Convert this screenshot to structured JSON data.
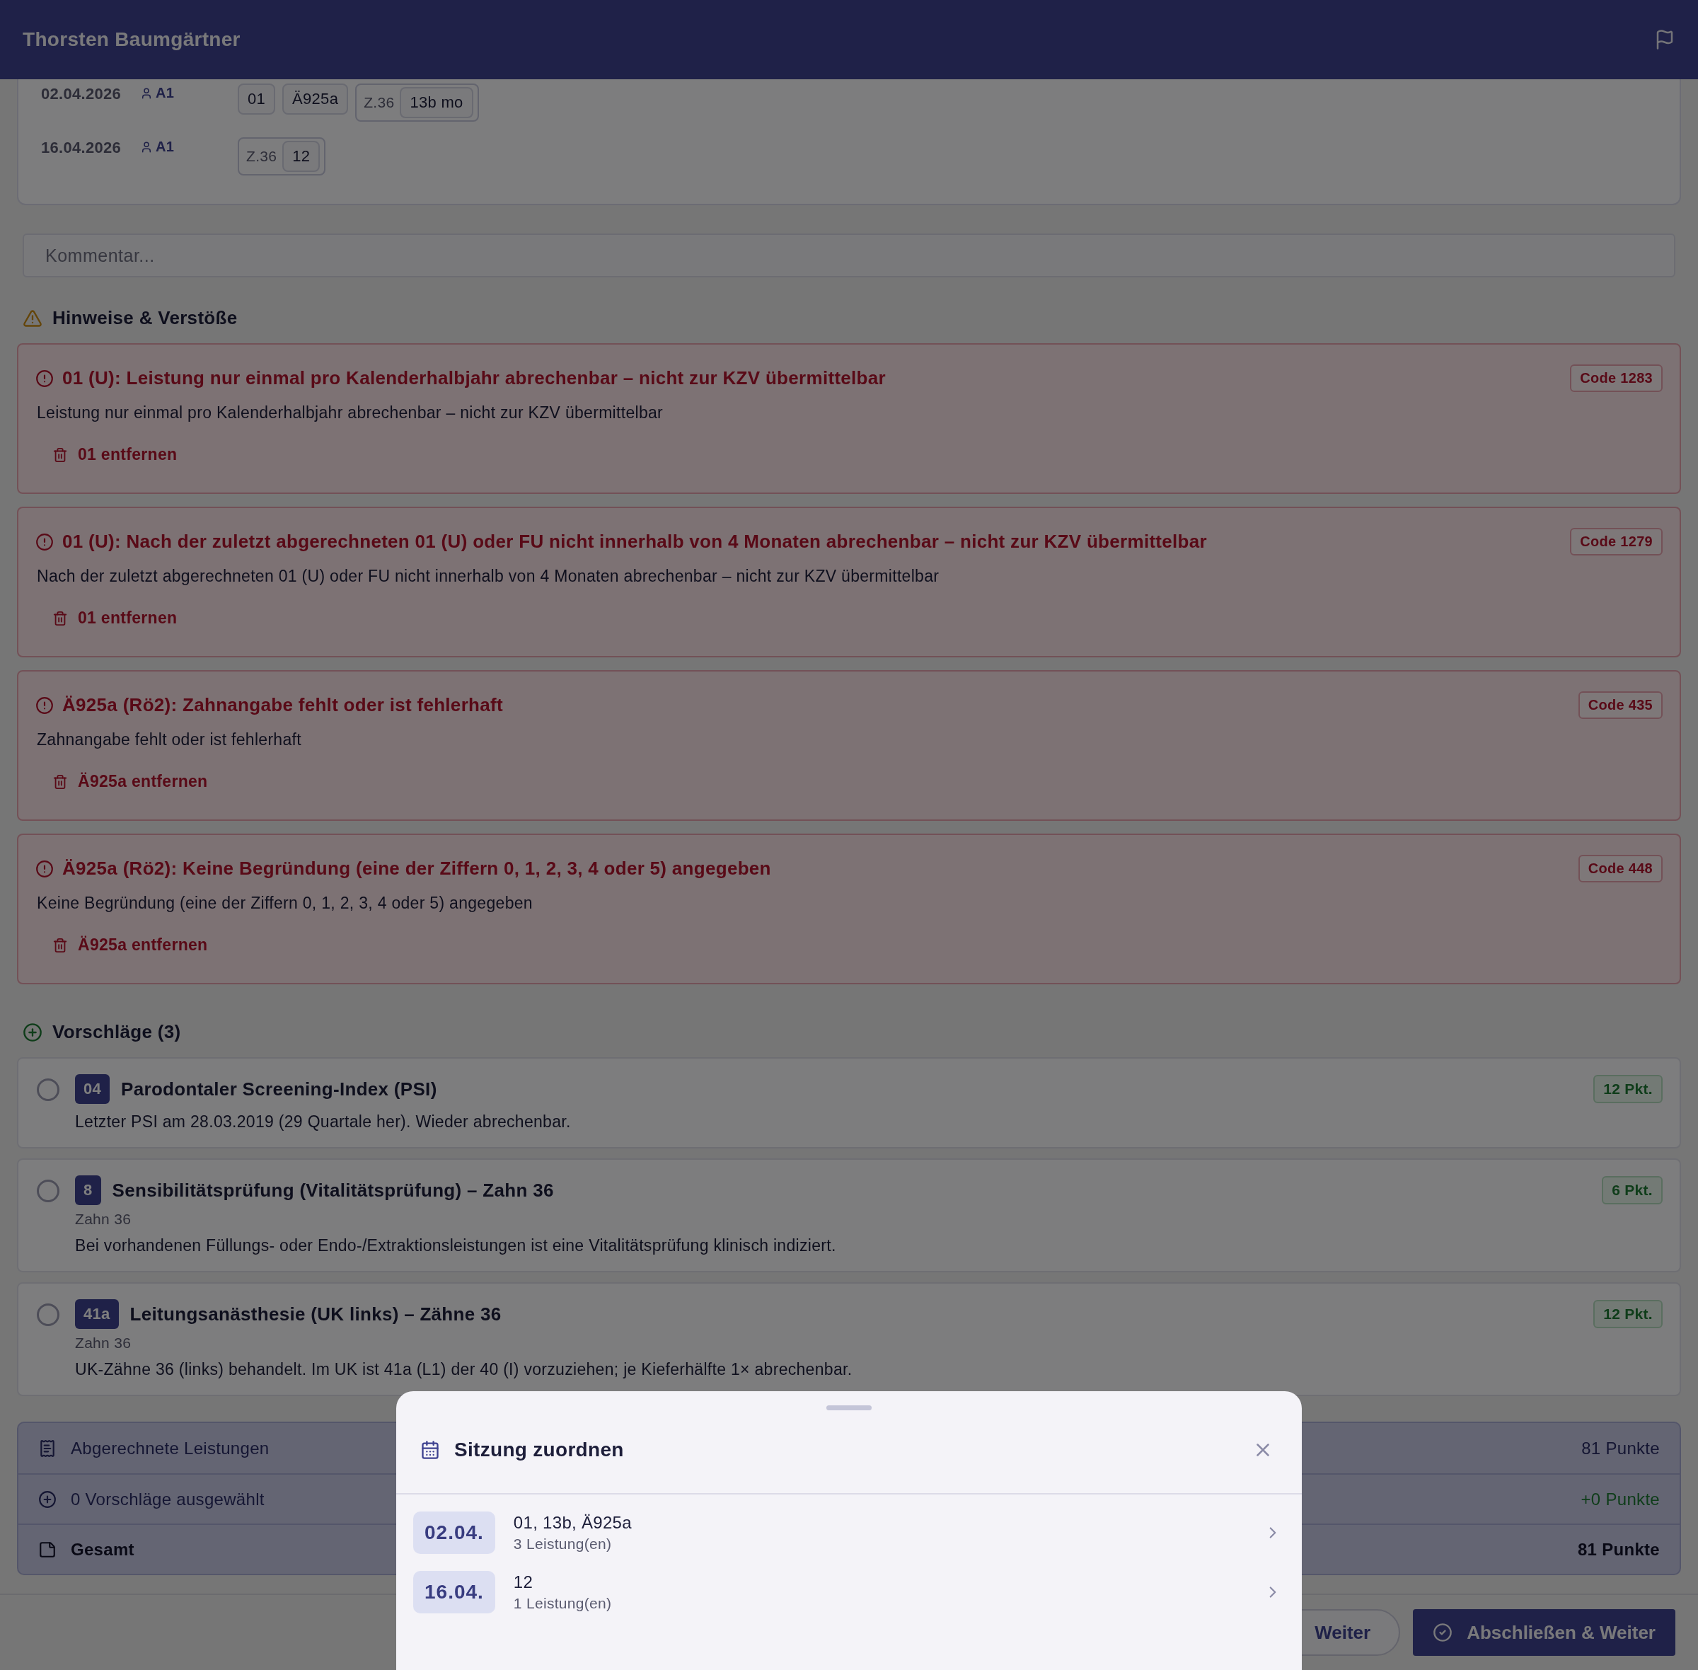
{
  "header": {
    "patient_name": "Thorsten Baumgärtner"
  },
  "sessions": [
    {
      "date": "02.04.2026",
      "practitioner": "A1",
      "chips": [
        {
          "kind": "code",
          "text": "01"
        },
        {
          "kind": "code",
          "text": "Ä925a"
        },
        {
          "kind": "tooth_group",
          "tooth": "Z.36",
          "codes": [
            "13b mo"
          ]
        }
      ]
    },
    {
      "date": "16.04.2026",
      "practitioner": "A1",
      "chips": [
        {
          "kind": "tooth_group",
          "tooth": "Z.36",
          "codes": [
            "12"
          ]
        }
      ]
    }
  ],
  "comment": {
    "placeholder": "Kommentar..."
  },
  "violations": {
    "title": "Hinweise & Verstöße",
    "items": [
      {
        "title": "01 (U): Leistung nur einmal pro Kalenderhalbjahr abrechenbar – nicht zur KZV übermittelbar",
        "description": "Leistung nur einmal pro Kalenderhalbjahr abrechenbar – nicht zur KZV übermittelbar",
        "code": "Code 1283",
        "action": "01 entfernen"
      },
      {
        "title": "01 (U): Nach der zuletzt abgerechneten 01 (U) oder FU nicht innerhalb von 4 Monaten abrechenbar – nicht zur KZV übermittelbar",
        "description": "Nach der zuletzt abgerechneten 01 (U) oder FU nicht innerhalb von 4 Monaten abrechenbar – nicht zur KZV übermittelbar",
        "code": "Code 1279",
        "action": "01 entfernen"
      },
      {
        "title": "Ä925a (Rö2): Zahnangabe fehlt oder ist fehlerhaft",
        "description": "Zahnangabe fehlt oder ist fehlerhaft",
        "code": "Code 435",
        "action": "Ä925a entfernen"
      },
      {
        "title": "Ä925a (Rö2): Keine Begründung (eine der Ziffern 0, 1, 2, 3, 4 oder 5) angegeben",
        "description": "Keine Begründung (eine der Ziffern 0, 1, 2, 3, 4 oder 5) angegeben",
        "code": "Code 448",
        "action": "Ä925a entfernen"
      }
    ]
  },
  "suggestions": {
    "title": "Vorschläge (3)",
    "items": [
      {
        "selected": false,
        "code": "04",
        "title": "Parodontaler Screening-Index (PSI)",
        "description": "Letzter PSI am 28.03.2019 (29 Quartale her). Wieder abrechenbar.",
        "points": "12 Pkt."
      },
      {
        "selected": false,
        "code": "8",
        "title": "Sensibilitätsprüfung (Vitalitätsprüfung) – Zahn 36",
        "tooth": "Zahn 36",
        "description": "Bei vorhandenen Füllungs- oder Endo-/Extraktionsleistungen ist eine Vitalitätsprüfung klinisch indiziert.",
        "points": "6 Pkt."
      },
      {
        "selected": false,
        "code": "41a",
        "title": "Leitungsanästhesie (UK links) – Zähne 36",
        "tooth": "Zahn 36",
        "description": "UK-Zähne 36 (links) behandelt. Im UK ist 41a (L1) der 40 (I) vorzuziehen; je Kieferhälfte 1× abrechenbar.",
        "points": "12 Pkt."
      }
    ]
  },
  "summary": [
    {
      "kind": "billed",
      "label": "Abgerechnete Leistungen",
      "value": "81 Punkte"
    },
    {
      "kind": "suggested",
      "label": "0 Vorschläge ausgewählt",
      "value": "+0 Punkte"
    },
    {
      "kind": "total",
      "label": "Gesamt",
      "value": "81 Punkte"
    }
  ],
  "footer": {
    "buttons": [
      {
        "kind": "secondary",
        "label": "Weiter"
      },
      {
        "kind": "primary",
        "label": "Abschließen & Weiter"
      }
    ]
  },
  "sheet": {
    "title": "Sitzung zuordnen",
    "sessions": [
      {
        "date": "02.04.",
        "codes": "01, 13b, Ä925a",
        "count": "3 Leistung(en)"
      },
      {
        "date": "16.04.",
        "codes": "12",
        "count": "1 Leistung(en)"
      }
    ]
  }
}
